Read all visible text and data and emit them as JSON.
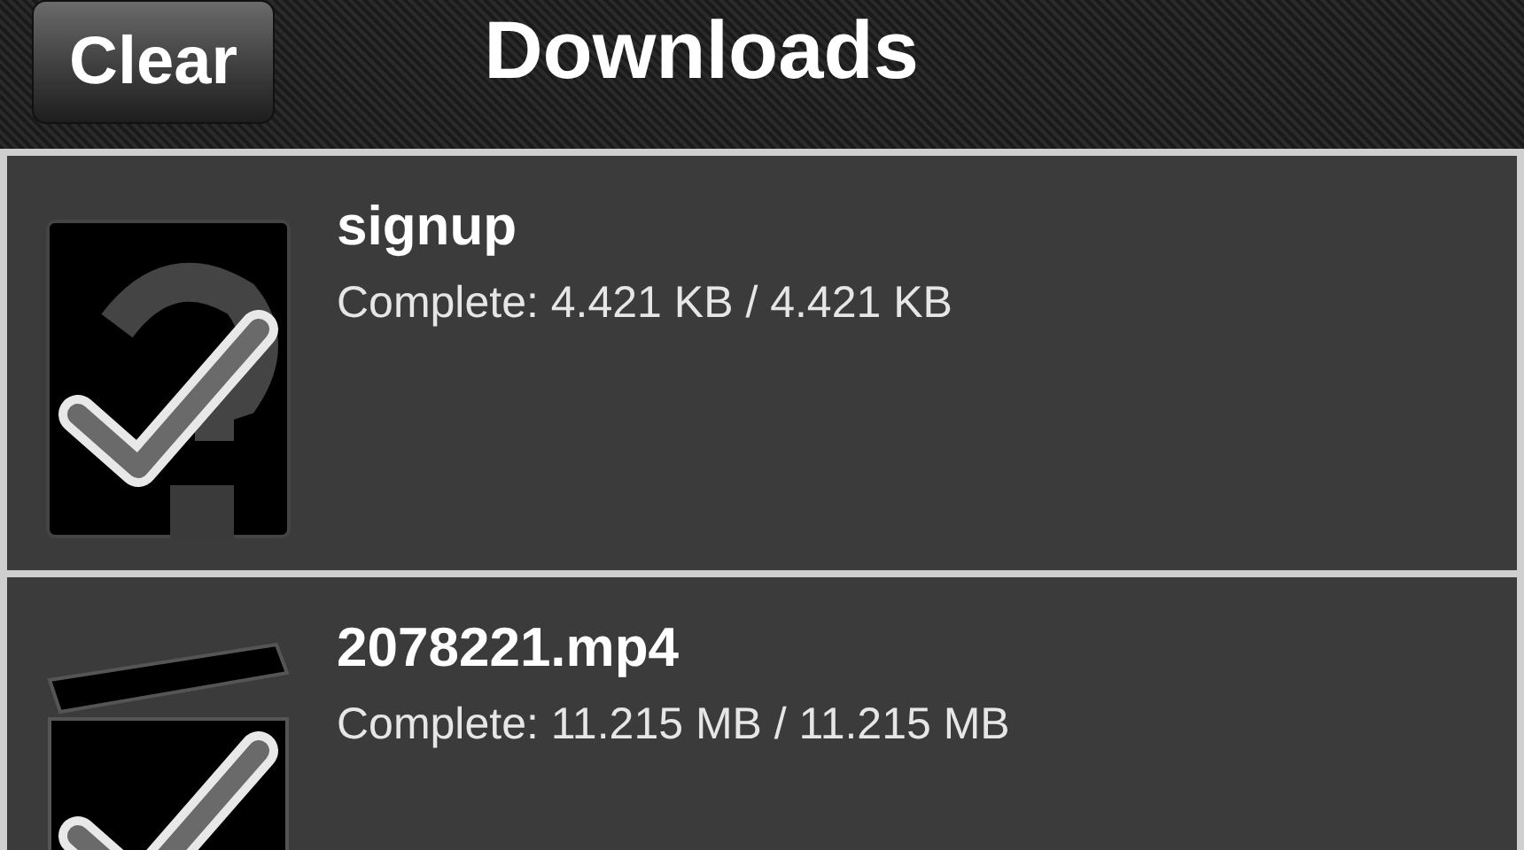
{
  "nav_bar": {
    "button": "Clear",
    "title": "Downloads"
  },
  "downloads": [
    {
      "kind": "unknown",
      "name": "signup",
      "status": "Complete: 4.421 KB / 4.421 KB"
    },
    {
      "kind": "video",
      "name": "2078221.mp4",
      "status": "Complete: 11.215 MB / 11.215 MB"
    }
  ]
}
